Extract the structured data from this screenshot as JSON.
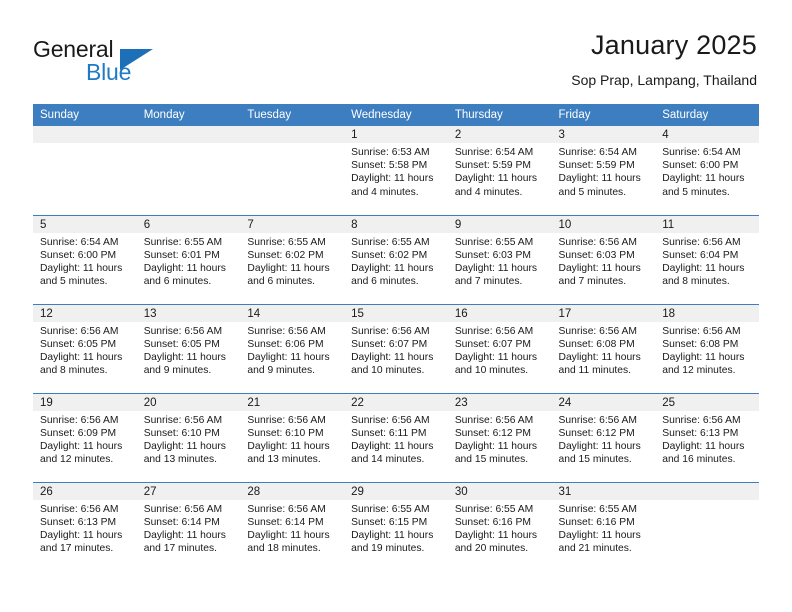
{
  "brand": {
    "name_part1": "General",
    "name_part2": "Blue"
  },
  "header": {
    "title": "January 2025",
    "subtitle": "Sop Prap, Lampang, Thailand"
  },
  "colors": {
    "header_blue": "#3c7ebf",
    "logo_blue": "#1f7ac4",
    "daynum_bg": "#f0f0f0"
  },
  "weekday_headers": [
    "Sunday",
    "Monday",
    "Tuesday",
    "Wednesday",
    "Thursday",
    "Friday",
    "Saturday"
  ],
  "weeks": [
    [
      {
        "day": "",
        "blank": true
      },
      {
        "day": "",
        "blank": true
      },
      {
        "day": "",
        "blank": true
      },
      {
        "day": "1",
        "sunrise": "Sunrise: 6:53 AM",
        "sunset": "Sunset: 5:58 PM",
        "daylight1": "Daylight: 11 hours",
        "daylight2": "and 4 minutes."
      },
      {
        "day": "2",
        "sunrise": "Sunrise: 6:54 AM",
        "sunset": "Sunset: 5:59 PM",
        "daylight1": "Daylight: 11 hours",
        "daylight2": "and 4 minutes."
      },
      {
        "day": "3",
        "sunrise": "Sunrise: 6:54 AM",
        "sunset": "Sunset: 5:59 PM",
        "daylight1": "Daylight: 11 hours",
        "daylight2": "and 5 minutes."
      },
      {
        "day": "4",
        "sunrise": "Sunrise: 6:54 AM",
        "sunset": "Sunset: 6:00 PM",
        "daylight1": "Daylight: 11 hours",
        "daylight2": "and 5 minutes."
      }
    ],
    [
      {
        "day": "5",
        "sunrise": "Sunrise: 6:54 AM",
        "sunset": "Sunset: 6:00 PM",
        "daylight1": "Daylight: 11 hours",
        "daylight2": "and 5 minutes."
      },
      {
        "day": "6",
        "sunrise": "Sunrise: 6:55 AM",
        "sunset": "Sunset: 6:01 PM",
        "daylight1": "Daylight: 11 hours",
        "daylight2": "and 6 minutes."
      },
      {
        "day": "7",
        "sunrise": "Sunrise: 6:55 AM",
        "sunset": "Sunset: 6:02 PM",
        "daylight1": "Daylight: 11 hours",
        "daylight2": "and 6 minutes."
      },
      {
        "day": "8",
        "sunrise": "Sunrise: 6:55 AM",
        "sunset": "Sunset: 6:02 PM",
        "daylight1": "Daylight: 11 hours",
        "daylight2": "and 6 minutes."
      },
      {
        "day": "9",
        "sunrise": "Sunrise: 6:55 AM",
        "sunset": "Sunset: 6:03 PM",
        "daylight1": "Daylight: 11 hours",
        "daylight2": "and 7 minutes."
      },
      {
        "day": "10",
        "sunrise": "Sunrise: 6:56 AM",
        "sunset": "Sunset: 6:03 PM",
        "daylight1": "Daylight: 11 hours",
        "daylight2": "and 7 minutes."
      },
      {
        "day": "11",
        "sunrise": "Sunrise: 6:56 AM",
        "sunset": "Sunset: 6:04 PM",
        "daylight1": "Daylight: 11 hours",
        "daylight2": "and 8 minutes."
      }
    ],
    [
      {
        "day": "12",
        "sunrise": "Sunrise: 6:56 AM",
        "sunset": "Sunset: 6:05 PM",
        "daylight1": "Daylight: 11 hours",
        "daylight2": "and 8 minutes."
      },
      {
        "day": "13",
        "sunrise": "Sunrise: 6:56 AM",
        "sunset": "Sunset: 6:05 PM",
        "daylight1": "Daylight: 11 hours",
        "daylight2": "and 9 minutes."
      },
      {
        "day": "14",
        "sunrise": "Sunrise: 6:56 AM",
        "sunset": "Sunset: 6:06 PM",
        "daylight1": "Daylight: 11 hours",
        "daylight2": "and 9 minutes."
      },
      {
        "day": "15",
        "sunrise": "Sunrise: 6:56 AM",
        "sunset": "Sunset: 6:07 PM",
        "daylight1": "Daylight: 11 hours",
        "daylight2": "and 10 minutes."
      },
      {
        "day": "16",
        "sunrise": "Sunrise: 6:56 AM",
        "sunset": "Sunset: 6:07 PM",
        "daylight1": "Daylight: 11 hours",
        "daylight2": "and 10 minutes."
      },
      {
        "day": "17",
        "sunrise": "Sunrise: 6:56 AM",
        "sunset": "Sunset: 6:08 PM",
        "daylight1": "Daylight: 11 hours",
        "daylight2": "and 11 minutes."
      },
      {
        "day": "18",
        "sunrise": "Sunrise: 6:56 AM",
        "sunset": "Sunset: 6:08 PM",
        "daylight1": "Daylight: 11 hours",
        "daylight2": "and 12 minutes."
      }
    ],
    [
      {
        "day": "19",
        "sunrise": "Sunrise: 6:56 AM",
        "sunset": "Sunset: 6:09 PM",
        "daylight1": "Daylight: 11 hours",
        "daylight2": "and 12 minutes."
      },
      {
        "day": "20",
        "sunrise": "Sunrise: 6:56 AM",
        "sunset": "Sunset: 6:10 PM",
        "daylight1": "Daylight: 11 hours",
        "daylight2": "and 13 minutes."
      },
      {
        "day": "21",
        "sunrise": "Sunrise: 6:56 AM",
        "sunset": "Sunset: 6:10 PM",
        "daylight1": "Daylight: 11 hours",
        "daylight2": "and 13 minutes."
      },
      {
        "day": "22",
        "sunrise": "Sunrise: 6:56 AM",
        "sunset": "Sunset: 6:11 PM",
        "daylight1": "Daylight: 11 hours",
        "daylight2": "and 14 minutes."
      },
      {
        "day": "23",
        "sunrise": "Sunrise: 6:56 AM",
        "sunset": "Sunset: 6:12 PM",
        "daylight1": "Daylight: 11 hours",
        "daylight2": "and 15 minutes."
      },
      {
        "day": "24",
        "sunrise": "Sunrise: 6:56 AM",
        "sunset": "Sunset: 6:12 PM",
        "daylight1": "Daylight: 11 hours",
        "daylight2": "and 15 minutes."
      },
      {
        "day": "25",
        "sunrise": "Sunrise: 6:56 AM",
        "sunset": "Sunset: 6:13 PM",
        "daylight1": "Daylight: 11 hours",
        "daylight2": "and 16 minutes."
      }
    ],
    [
      {
        "day": "26",
        "sunrise": "Sunrise: 6:56 AM",
        "sunset": "Sunset: 6:13 PM",
        "daylight1": "Daylight: 11 hours",
        "daylight2": "and 17 minutes."
      },
      {
        "day": "27",
        "sunrise": "Sunrise: 6:56 AM",
        "sunset": "Sunset: 6:14 PM",
        "daylight1": "Daylight: 11 hours",
        "daylight2": "and 17 minutes."
      },
      {
        "day": "28",
        "sunrise": "Sunrise: 6:56 AM",
        "sunset": "Sunset: 6:14 PM",
        "daylight1": "Daylight: 11 hours",
        "daylight2": "and 18 minutes."
      },
      {
        "day": "29",
        "sunrise": "Sunrise: 6:55 AM",
        "sunset": "Sunset: 6:15 PM",
        "daylight1": "Daylight: 11 hours",
        "daylight2": "and 19 minutes."
      },
      {
        "day": "30",
        "sunrise": "Sunrise: 6:55 AM",
        "sunset": "Sunset: 6:16 PM",
        "daylight1": "Daylight: 11 hours",
        "daylight2": "and 20 minutes."
      },
      {
        "day": "31",
        "sunrise": "Sunrise: 6:55 AM",
        "sunset": "Sunset: 6:16 PM",
        "daylight1": "Daylight: 11 hours",
        "daylight2": "and 21 minutes."
      },
      {
        "day": "",
        "blank": true
      }
    ]
  ]
}
